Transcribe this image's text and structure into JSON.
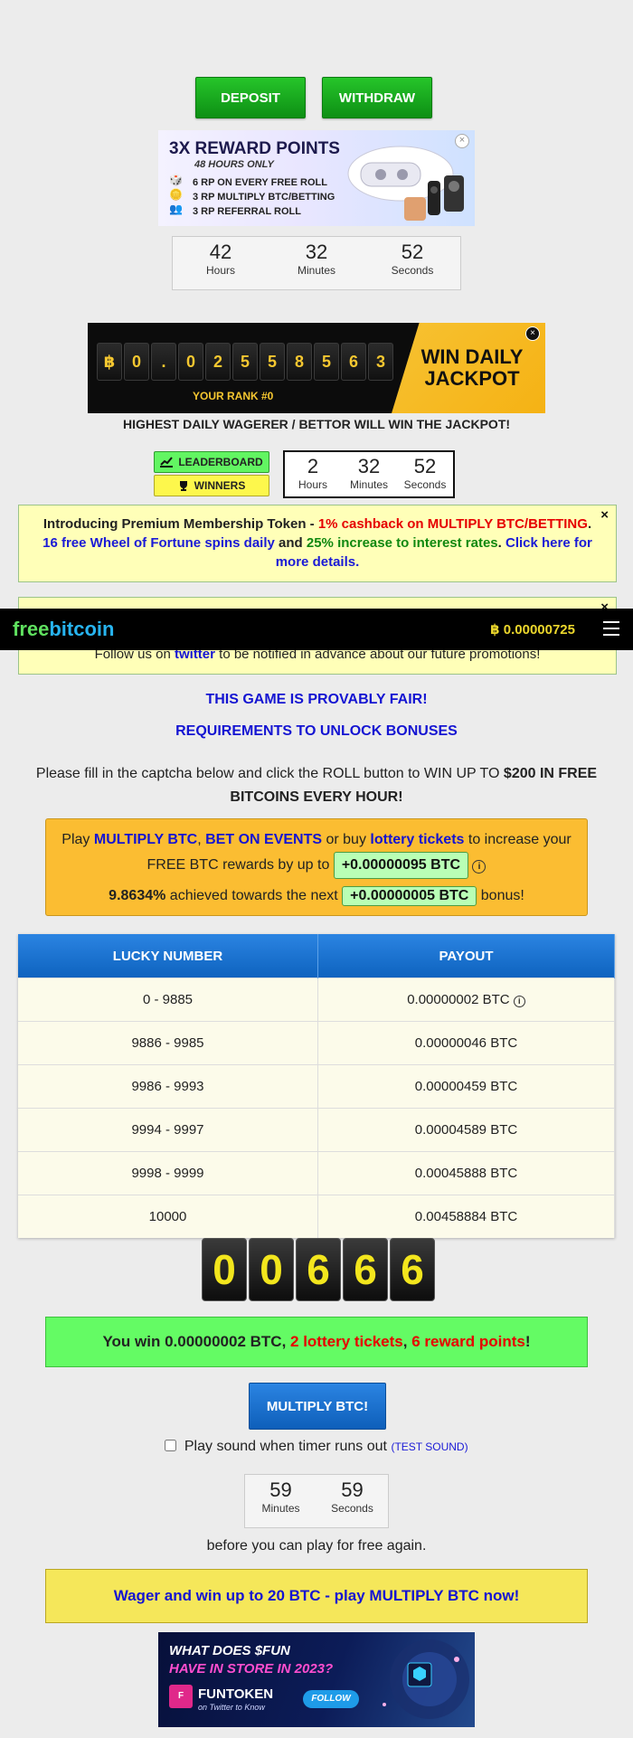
{
  "top_buttons": {
    "deposit": "DEPOSIT",
    "withdraw": "WITHDRAW"
  },
  "promo_banner": {
    "title": "3X REWARD POINTS",
    "subtitle": "48 HOURS ONLY",
    "lines": [
      "6 RP ON EVERY FREE ROLL",
      "3 RP MULTIPLY BTC/BETTING",
      "3 RP REFERRAL ROLL"
    ],
    "close": "×"
  },
  "promo_timer": {
    "hours": "42",
    "hours_label": "Hours",
    "minutes": "32",
    "minutes_label": "Minutes",
    "seconds": "52",
    "seconds_label": "Seconds"
  },
  "jackpot": {
    "currency_symbol": "฿",
    "digits": [
      "0",
      ".",
      "0",
      "2",
      "5",
      "5",
      "8",
      "5",
      "6",
      "3"
    ],
    "rank": "YOUR RANK #0",
    "win_title": "WIN DAILY JACKPOT",
    "close": "×"
  },
  "jackpot_caption": "HIGHEST DAILY WAGERER / BETTOR WILL WIN THE JACKPOT!",
  "leaderboard_button": "LEADERBOARD",
  "winners_button": "WINNERS",
  "jackpot_timer": {
    "hours": "2",
    "hours_label": "Hours",
    "minutes": "32",
    "minutes_label": "Minutes",
    "seconds": "52",
    "seconds_label": "Seconds"
  },
  "premium_notice": {
    "intro": "Introducing Premium Membership Token - ",
    "cashback": "1% cashback on MULTIPLY BTC/BETTING",
    "sep": ". ",
    "spins": "16 free Wheel of Fortune spins daily",
    "and": " and ",
    "interest": "25% increase to interest rates",
    "dot": ". ",
    "link": "Click here for more details.",
    "close": "×"
  },
  "twitter_notice": {
    "before": "Follow us on ",
    "link": "twitter",
    "after": " to be notified in advance about our future promotions!",
    "close": "×"
  },
  "navbar": {
    "logo_free": "free",
    "logo_bitcoin": "bitcoin",
    "balance": "฿ 0.00000725"
  },
  "provably_fair": "THIS GAME IS PROVABLY FAIR!",
  "requirements": "REQUIREMENTS TO UNLOCK BONUSES",
  "instructions": {
    "text": "Please fill in the captcha below and click the ROLL button to WIN UP TO ",
    "bold": "$200 IN FREE BITCOINS EVERY HOUR!"
  },
  "reward_box": {
    "play": "Play ",
    "multiply": "MULTIPLY BTC",
    "comma": ", ",
    "bet": "BET ON EVENTS",
    "or": " or buy ",
    "lottery": "lottery tickets",
    "rest": " to increase your FREE BTC rewards by up to ",
    "amount": "+0.00000095 BTC",
    "percent": "9.8634%",
    "achieved": " achieved towards the next ",
    "next_amount": "+0.00000005 BTC",
    "bonus": " bonus!"
  },
  "payout_table": {
    "headers": [
      "LUCKY NUMBER",
      "PAYOUT"
    ],
    "rows": [
      [
        "0 - 9885",
        "0.00000002 BTC"
      ],
      [
        "9886 - 9985",
        "0.00000046 BTC"
      ],
      [
        "9986 - 9993",
        "0.00000459 BTC"
      ],
      [
        "9994 - 9997",
        "0.00004589 BTC"
      ],
      [
        "9998 - 9999",
        "0.00045888 BTC"
      ],
      [
        "10000",
        "0.00458884 BTC"
      ]
    ]
  },
  "roll_digits": [
    "0",
    "0",
    "6",
    "6",
    "6"
  ],
  "win_message": {
    "prefix": "You win 0.00000002 BTC, ",
    "tickets": "2 lottery tickets",
    "comma": ", ",
    "points": "6 reward points",
    "end": "!"
  },
  "multiply_button": "MULTIPLY BTC!",
  "sound": {
    "label": "Play sound when timer runs out",
    "test": "(TEST SOUND)"
  },
  "countdown": {
    "minutes": "59",
    "minutes_label": "Minutes",
    "seconds": "59",
    "seconds_label": "Seconds"
  },
  "before_text": "before you can play for free again.",
  "wager_text": "Wager and win up to 20 BTC - play MULTIPLY BTC now!",
  "fun_banner": {
    "line1": "WHAT DOES $FUN",
    "line2": "HAVE IN STORE IN 2023?",
    "brand": "FUNTOKEN",
    "tagline": "on Twitter to Know",
    "follow": "FOLLOW"
  }
}
